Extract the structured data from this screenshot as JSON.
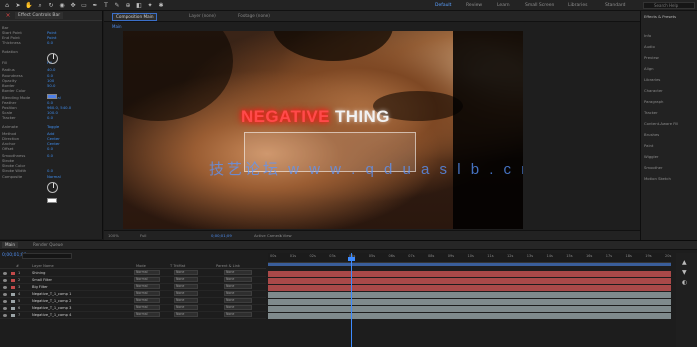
{
  "toolbar": {
    "icons": [
      "home-icon",
      "selection-tool-icon",
      "hand-tool-icon",
      "zoom-tool-icon",
      "rotate-tool-icon",
      "camera-tool-icon",
      "pan-behind-icon",
      "shape-tool-icon",
      "pen-tool-icon",
      "type-tool-icon",
      "brush-tool-icon",
      "clone-stamp-icon",
      "eraser-icon",
      "roto-brush-icon",
      "puppet-tool-icon"
    ],
    "workspaces": [
      {
        "label": "Default",
        "active": true
      },
      {
        "label": "Review",
        "active": false
      },
      {
        "label": "Learn",
        "active": false
      },
      {
        "label": "Small Screen",
        "active": false
      },
      {
        "label": "Libraries",
        "active": false
      },
      {
        "label": "Standard",
        "active": false
      }
    ],
    "search_placeholder": "Search Help"
  },
  "fx_panel": {
    "tab_label": "Effect Controls Bar",
    "rows": [
      {
        "label": "Bar",
        "value": ""
      },
      {
        "label": "Start Point",
        "value": "Point"
      },
      {
        "label": "End Point",
        "value": "Point"
      },
      {
        "label": "Thickness",
        "value": "0.0"
      },
      {
        "label": "Rotation",
        "value": ""
      },
      {
        "label": "Fill",
        "value": "Fill"
      },
      {
        "label": "Radius",
        "value": "40.0"
      },
      {
        "label": "Roundness",
        "value": "0.0"
      },
      {
        "label": "Opacity",
        "value": "100"
      },
      {
        "label": "Border",
        "value": "50.0"
      },
      {
        "label": "Border Color",
        "value": ""
      },
      {
        "label": "Blending Mode",
        "value": "Normal"
      },
      {
        "label": "Feather",
        "value": "0.0"
      },
      {
        "label": "Position",
        "value": "960.0, 540.0"
      },
      {
        "label": "Scale",
        "value": "100.0"
      },
      {
        "label": "Tracker",
        "value": "0.0"
      },
      {
        "label": "Animate",
        "value": "Toggle"
      },
      {
        "label": "Method",
        "value": "Add"
      },
      {
        "label": "Direction",
        "value": "Center"
      },
      {
        "label": "Anchor",
        "value": "Center"
      },
      {
        "label": "Offset",
        "value": "0.0"
      },
      {
        "label": "Smoothness",
        "value": "0.0"
      },
      {
        "label": "Stroke",
        "value": ""
      },
      {
        "label": "Stroke Color",
        "value": ""
      },
      {
        "label": "Stroke Width",
        "value": "0.0"
      },
      {
        "label": "Composite",
        "value": "Normal"
      }
    ]
  },
  "comp_panel": {
    "tabs": [
      {
        "label": "Composition Main",
        "active": true
      },
      {
        "label": "Layer (none)",
        "active": false
      },
      {
        "label": "Footage (none)",
        "active": false
      }
    ],
    "subtab": "Main",
    "footer": {
      "zoom": "100%",
      "resolution": "Full",
      "timecode": "0;00;01;09",
      "camera": "Active Camera",
      "views": "1 View"
    }
  },
  "overlay": {
    "word1": "NEGATIVE",
    "word2": "THING",
    "watermark": "技艺论坛  w w w . q d u a s l b . c n",
    "colors": {
      "word1": "#ff4a4a",
      "word2": "#f2f2f2"
    }
  },
  "right_panel": {
    "title": "Effects & Presets",
    "items": [
      "Info",
      "Audio",
      "Preview",
      "Align",
      "Libraries",
      "Character",
      "Paragraph",
      "Tracker",
      "Content-Aware Fill",
      "Brushes",
      "Paint",
      "Wiggler",
      "Smoother",
      "Motion Sketch"
    ]
  },
  "timeline": {
    "tabs": [
      {
        "label": "Main",
        "active": true
      },
      {
        "label": "Render Queue",
        "active": false
      }
    ],
    "timecode": "0;00;01;09",
    "headers": [
      "#",
      "Layer Name",
      "Mode",
      "T TrkMat",
      "Parent & Link"
    ],
    "ruler_labels": [
      "00s",
      "01s",
      "02s",
      "03s",
      "04s",
      "05s",
      "06s",
      "07s",
      "08s",
      "09s",
      "10s",
      "11s",
      "12s",
      "13s",
      "14s",
      "15s",
      "16s",
      "17s",
      "18s",
      "19s",
      "20s"
    ],
    "layers": [
      {
        "num": "1",
        "name": "Shining",
        "mode": "Normal",
        "trkmat": "None",
        "parent": "None",
        "color": "#c24a4a",
        "track_color": "#a94949"
      },
      {
        "num": "2",
        "name": "Small Filter",
        "mode": "Normal",
        "trkmat": "None",
        "parent": "None",
        "color": "#c24a4a",
        "track_color": "#a94949"
      },
      {
        "num": "3",
        "name": "Big Filter",
        "mode": "Normal",
        "trkmat": "None",
        "parent": "None",
        "color": "#c24a4a",
        "track_color": "#a94949"
      },
      {
        "num": "4",
        "name": "Negative_T_1_comp 1",
        "mode": "Normal",
        "trkmat": "None",
        "parent": "None",
        "color": "#9aa3a6",
        "track_color": "#7f8a8c"
      },
      {
        "num": "5",
        "name": "Negative_T_1_comp 2",
        "mode": "Normal",
        "trkmat": "None",
        "parent": "None",
        "color": "#9aa3a6",
        "track_color": "#7f8a8c"
      },
      {
        "num": "6",
        "name": "Negative_T_1_comp 3",
        "mode": "Normal",
        "trkmat": "None",
        "parent": "None",
        "color": "#9aa3a6",
        "track_color": "#7f8a8c"
      },
      {
        "num": "7",
        "name": "Negative_T_1_comp 4",
        "mode": "Normal",
        "trkmat": "None",
        "parent": "None",
        "color": "#9aa3a6",
        "track_color": "#7f8a8c"
      }
    ]
  }
}
